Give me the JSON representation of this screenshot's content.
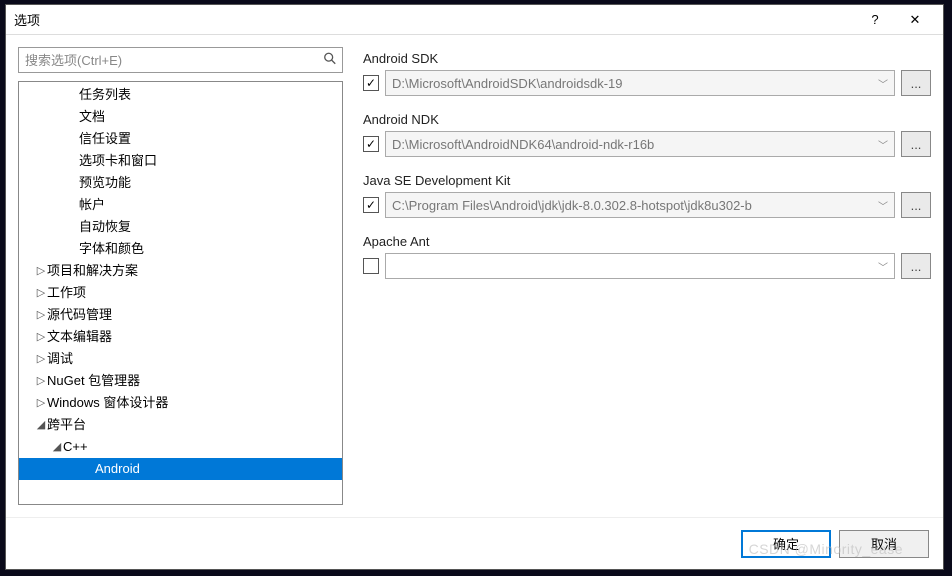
{
  "title": "选项",
  "search_placeholder": "搜索选项(Ctrl+E)",
  "tree": [
    {
      "label": "任务列表",
      "indent": 3,
      "arrow": ""
    },
    {
      "label": "文档",
      "indent": 3,
      "arrow": ""
    },
    {
      "label": "信任设置",
      "indent": 3,
      "arrow": ""
    },
    {
      "label": "选项卡和窗口",
      "indent": 3,
      "arrow": ""
    },
    {
      "label": "预览功能",
      "indent": 3,
      "arrow": ""
    },
    {
      "label": "帐户",
      "indent": 3,
      "arrow": ""
    },
    {
      "label": "自动恢复",
      "indent": 3,
      "arrow": ""
    },
    {
      "label": "字体和颜色",
      "indent": 3,
      "arrow": ""
    },
    {
      "label": "项目和解决方案",
      "indent": 1,
      "arrow": "▷"
    },
    {
      "label": "工作项",
      "indent": 1,
      "arrow": "▷"
    },
    {
      "label": "源代码管理",
      "indent": 1,
      "arrow": "▷"
    },
    {
      "label": "文本编辑器",
      "indent": 1,
      "arrow": "▷"
    },
    {
      "label": "调试",
      "indent": 1,
      "arrow": "▷"
    },
    {
      "label": "NuGet 包管理器",
      "indent": 1,
      "arrow": "▷"
    },
    {
      "label": "Windows 窗体设计器",
      "indent": 1,
      "arrow": "▷"
    },
    {
      "label": "跨平台",
      "indent": 1,
      "arrow": "◢"
    },
    {
      "label": "C++",
      "indent": 2,
      "arrow": "◢"
    },
    {
      "label": "Android",
      "indent": 4,
      "arrow": "",
      "selected": true
    }
  ],
  "fields": [
    {
      "label": "Android SDK",
      "checked": true,
      "value": "D:\\Microsoft\\AndroidSDK\\androidsdk-19",
      "disabled": true
    },
    {
      "label": "Android NDK",
      "checked": true,
      "value": "D:\\Microsoft\\AndroidNDK64\\android-ndk-r16b",
      "disabled": true
    },
    {
      "label": "Java SE Development Kit",
      "checked": true,
      "value": "C:\\Program Files\\Android\\jdk\\jdk-8.0.302.8-hotspot\\jdk8u302-b",
      "disabled": true
    },
    {
      "label": "Apache Ant",
      "checked": false,
      "value": "",
      "disabled": false
    }
  ],
  "browse_label": "...",
  "ok_label": "确定",
  "cancel_label": "取消",
  "watermark": "CSDN @Minority_ease"
}
